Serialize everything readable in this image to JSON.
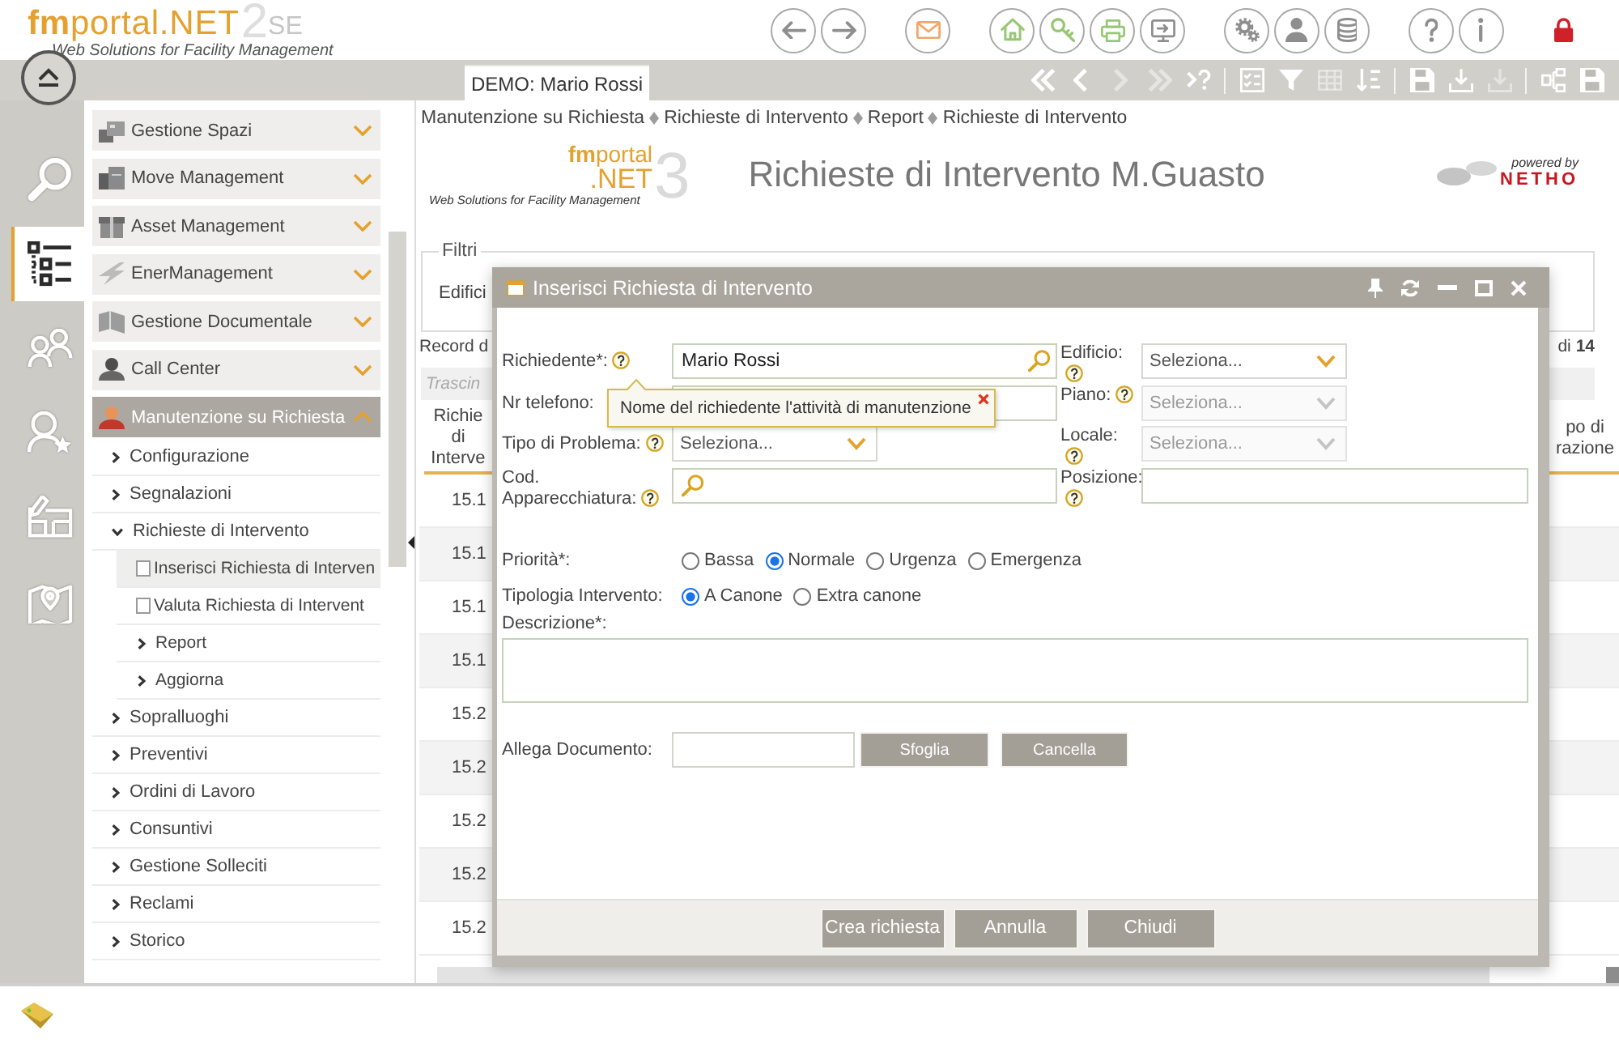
{
  "header": {
    "brand": "**fm**portal.NET",
    "edition_number": "2",
    "edition_suffix": "SE",
    "tagline": "Web Solutions for Facility Management"
  },
  "top_toolbar": {
    "groups": [
      {
        "buttons": [
          {
            "kind": "back"
          },
          {
            "kind": "forward"
          }
        ]
      },
      {
        "buttons": [
          {
            "kind": "mail"
          }
        ]
      },
      {
        "buttons": [
          {
            "kind": "home"
          },
          {
            "kind": "key"
          },
          {
            "kind": "print"
          },
          {
            "kind": "export"
          }
        ]
      },
      {
        "buttons": [
          {
            "kind": "settings"
          },
          {
            "kind": "user"
          },
          {
            "kind": "database"
          }
        ]
      },
      {
        "buttons": [
          {
            "kind": "help"
          },
          {
            "kind": "info"
          }
        ]
      },
      {
        "buttons": [
          {
            "kind": "lock"
          }
        ]
      }
    ]
  },
  "tabs": [
    {
      "label": "DEMO: Mario Rossi",
      "selected": true
    }
  ],
  "nav_toolbar": {
    "groups": [
      {
        "buttons": [
          {
            "kind": "first",
            "disabled": false
          },
          {
            "kind": "previous",
            "disabled": false
          },
          {
            "kind": "next",
            "disabled": true
          },
          {
            "kind": "last",
            "disabled": true
          },
          {
            "kind": "goto",
            "disabled": false
          }
        ]
      },
      {
        "buttons": [
          {
            "kind": "select",
            "disabled": false
          },
          {
            "kind": "filter",
            "disabled": false
          },
          {
            "kind": "columns",
            "disabled": true
          },
          {
            "kind": "sort",
            "disabled": false
          }
        ]
      },
      {
        "buttons": [
          {
            "kind": "save",
            "disabled": false
          },
          {
            "kind": "import",
            "disabled": false
          },
          {
            "kind": "export",
            "disabled": true
          }
        ]
      },
      {
        "buttons": [
          {
            "kind": "tree",
            "disabled": false
          },
          {
            "kind": "save",
            "disabled": false
          }
        ]
      }
    ]
  },
  "rail": [
    {
      "kind": "search",
      "selected": false
    },
    {
      "kind": "menu",
      "selected": true
    },
    {
      "kind": "people",
      "selected": false
    },
    {
      "kind": "user-star",
      "selected": false
    },
    {
      "kind": "plan",
      "selected": false
    },
    {
      "kind": "map",
      "selected": false
    }
  ],
  "sidebar": {
    "sections": [
      {
        "label": "Gestione Spazi",
        "kind": "spaces",
        "expanded": false
      },
      {
        "label": "Move Management",
        "kind": "move",
        "expanded": false
      },
      {
        "label": "Asset Management",
        "kind": "asset",
        "expanded": false
      },
      {
        "label": "EnerManagement",
        "kind": "energy",
        "expanded": false
      },
      {
        "label": "Gestione Documentale",
        "kind": "documents",
        "expanded": false
      },
      {
        "label": "Call Center",
        "kind": "call",
        "expanded": false
      },
      {
        "label": "Manutenzione su Richiesta",
        "kind": "maintenance",
        "expanded": true,
        "children": [
          {
            "label": "Configurazione",
            "expanded": false
          },
          {
            "label": "Segnalazioni",
            "expanded": false
          },
          {
            "label": "Richieste di Intervento",
            "expanded": true,
            "children": [
              {
                "label": "Inserisci Richiesta di Interven",
                "kind": "page",
                "selected": true
              },
              {
                "label": "Valuta Richiesta di Intervent",
                "kind": "page",
                "selected": false
              },
              {
                "label": "Report",
                "kind": "folder",
                "expanded": false,
                "selected": false
              },
              {
                "label": "Aggiorna",
                "kind": "folder",
                "expanded": false,
                "selected": false
              }
            ]
          },
          {
            "label": "Sopralluoghi",
            "expanded": false
          },
          {
            "label": "Preventivi",
            "expanded": false
          },
          {
            "label": "Ordini di Lavoro",
            "expanded": false
          },
          {
            "label": "Consuntivi",
            "expanded": false
          },
          {
            "label": "Gestione Solleciti",
            "expanded": false
          },
          {
            "label": "Reclami",
            "expanded": false
          },
          {
            "label": "Storico",
            "expanded": false
          }
        ]
      }
    ]
  },
  "breadcrumb": [
    "Manutenzione su Richiesta",
    "Richieste di Intervento",
    "Report",
    "Richieste di Intervento"
  ],
  "page_header": {
    "logo_brand": "**fm**portal",
    "logo_suffix": ".NET",
    "logo_version": "3",
    "logo_tagline": "Web Solutions for Facility Management",
    "title": "Richieste di Intervento M.Guasto",
    "powered_by": "powered by",
    "vendor": "NETHO"
  },
  "filters": {
    "legend": "Filtri",
    "field_label": "Edifici"
  },
  "records": {
    "summary": "Record d",
    "pager": "di **14**"
  },
  "grouping_hint": "Trascin",
  "table": {
    "columns": [
      {
        "label": "Richie di Interve"
      },
      {
        "label": "po di razione"
      }
    ],
    "rows": [
      {
        "column_1": "15.1"
      },
      {
        "column_1": "15.1"
      },
      {
        "column_1": "15.1"
      },
      {
        "column_1": "15.1"
      },
      {
        "column_1": "15.2"
      },
      {
        "column_1": "15.2"
      },
      {
        "column_1": "15.2"
      },
      {
        "column_1": "15.2"
      },
      {
        "column_1": "15.2"
      }
    ]
  },
  "dialog": {
    "title": "Inserisci Richiesta di Intervento",
    "fields": [
      {
        "label": "Richiedente*:",
        "help": true,
        "kind": "lookup",
        "value": "Mario Rossi"
      },
      {
        "label": "Edificio:",
        "help": true,
        "kind": "select",
        "placeholder": "Seleziona...",
        "disabled": false
      },
      {
        "label": "Nr telefono:",
        "help": false,
        "kind": "text"
      },
      {
        "label": "Piano:",
        "help": true,
        "kind": "select",
        "placeholder": "Seleziona...",
        "disabled": true
      },
      {
        "label": "Tipo di Problema:",
        "help": true,
        "kind": "select",
        "placeholder": "Seleziona...",
        "disabled": false
      },
      {
        "label": "Locale:",
        "help": true,
        "kind": "select",
        "placeholder": "Seleziona...",
        "disabled": true
      },
      {
        "label": "Cod. Apparecchiatura:",
        "help": true,
        "kind": "lookup"
      },
      {
        "label": "Posizione:",
        "help": true,
        "kind": "text"
      }
    ],
    "tooltip": {
      "text": "Nome del richiedente l'attività di manutenzione"
    },
    "priority": {
      "label": "Priorità*:",
      "options": [
        {
          "label": "Bassa",
          "selected": false
        },
        {
          "label": "Normale",
          "selected": true
        },
        {
          "label": "Urgenza",
          "selected": false
        },
        {
          "label": "Emergenza",
          "selected": false
        }
      ]
    },
    "intervention_type": {
      "label": "Tipologia Intervento:",
      "options": [
        {
          "label": "A Canone",
          "selected": true
        },
        {
          "label": "Extra canone",
          "selected": false
        }
      ]
    },
    "description": {
      "label": "Descrizione*:"
    },
    "attachment": {
      "label": "Allega Documento:",
      "buttons": [
        "Sfoglia",
        "Cancella"
      ]
    },
    "buttons": [
      "Crea richiesta",
      "Annulla",
      "Chiudi"
    ]
  }
}
